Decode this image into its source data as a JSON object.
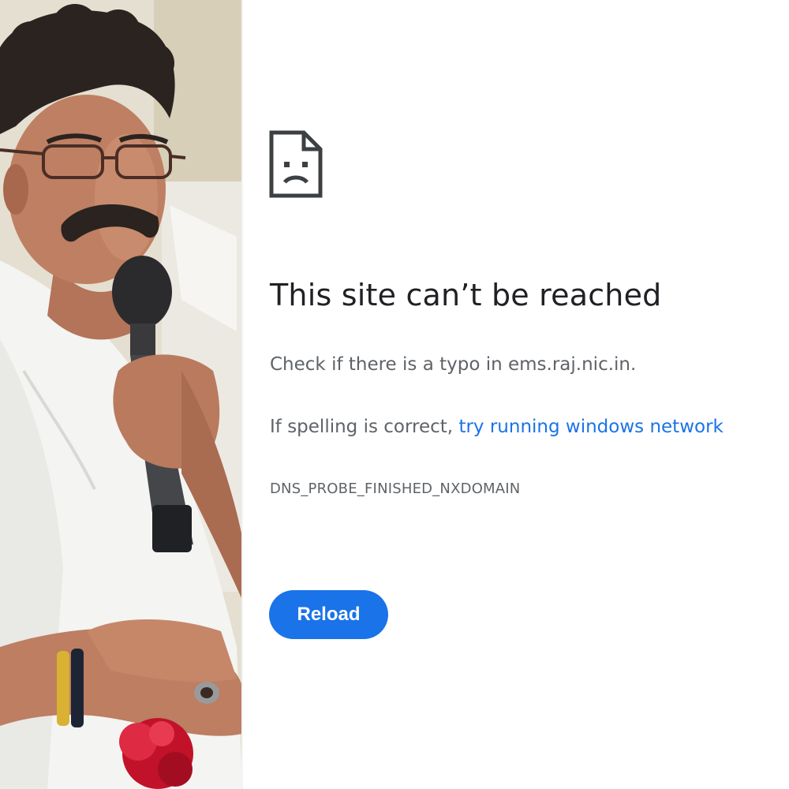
{
  "error": {
    "icon": "sad-file-icon",
    "headline": "This site can’t be reached",
    "typo_prefix": "Check if there is a typo in ",
    "host": "ems.raj.nic.in",
    "typo_suffix": ".",
    "spelling_prefix": "If spelling is correct, ",
    "diagnostics_link": "try running windows network",
    "error_code": "DNS_PROBE_FINISHED_NXDOMAIN",
    "reload_label": "Reload"
  },
  "photo": {
    "subject": "man-speaking-into-microphone"
  },
  "colors": {
    "accent": "#1a73e8",
    "headline_text": "#202124",
    "body_text": "#5f6368",
    "background": "#ffffff"
  }
}
